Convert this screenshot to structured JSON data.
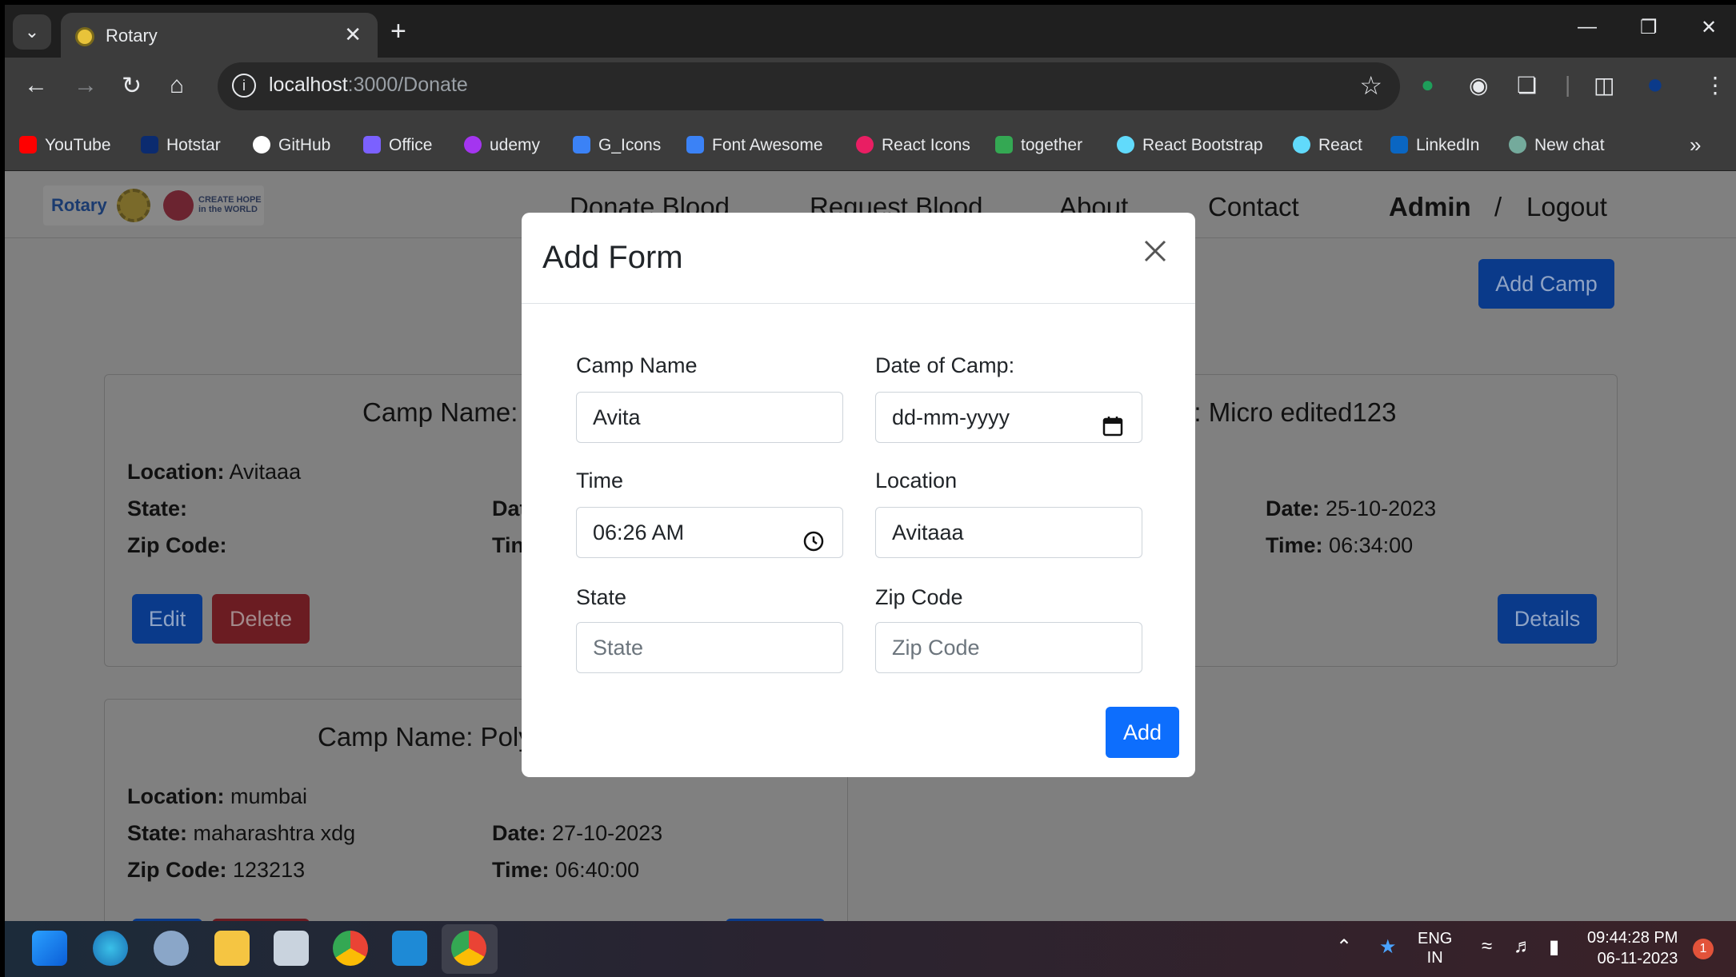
{
  "browser": {
    "tab_title": "Rotary",
    "url_host": "localhost",
    "url_path": ":3000/Donate",
    "bookmarks": [
      "YouTube",
      "Hotstar",
      "GitHub",
      "Office",
      "udemy",
      "G_Icons",
      "Font Awesome",
      "React Icons",
      "together",
      "React Bootstrap",
      "React",
      "LinkedIn",
      "New chat"
    ],
    "bookmark_colors": [
      "#ff0000",
      "#0b2b6f",
      "#ffffff",
      "#7b61ff",
      "#a435f0",
      "#3b82f6",
      "#3b82f6",
      "#e91e63",
      "#34a853",
      "#61dafb",
      "#61dafb",
      "#0a66c2",
      "#74aa9c"
    ]
  },
  "site": {
    "logo_text": "Rotary",
    "logo_tagline": "CREATE HOPE in the WORLD",
    "nav": {
      "donate": "Donate Blood",
      "request": "Request Blood",
      "about": "About",
      "contact": "Contact",
      "admin": "Admin",
      "separator": "/",
      "logout": "Logout"
    },
    "add_camp": "Add Camp"
  },
  "cards": {
    "card1": {
      "title": "Camp Name:",
      "location_label": "Location:",
      "location_value": "Avitaaa",
      "state_label": "State:",
      "zip_label": "Zip Code:",
      "date_label_partial": "Dat",
      "time_label_partial": "Tin",
      "edit": "Edit",
      "delete": "Delete"
    },
    "card2": {
      "title_partial": "e: Micro edited123",
      "date_label": "Date:",
      "date_value": "25-10-2023",
      "time_label": "Time:",
      "time_value": "06:34:00",
      "details": "Details"
    },
    "card3": {
      "title_partial": "Camp Name: Poly",
      "location_label": "Location:",
      "location_value": "mumbai",
      "state_label": "State:",
      "state_value": "maharashtra xdg",
      "zip_label": "Zip Code:",
      "zip_value": "123213",
      "date_label": "Date:",
      "date_value": "27-10-2023",
      "time_label": "Time:",
      "time_value": "06:40:00"
    }
  },
  "modal": {
    "title": "Add Form",
    "fields": {
      "camp_name": {
        "label": "Camp Name",
        "value": "Avita"
      },
      "date": {
        "label": "Date of Camp:",
        "value": "dd-mm-yyyy"
      },
      "time": {
        "label": "Time",
        "value": "06:26 AM"
      },
      "location": {
        "label": "Location",
        "value": "Avitaaa"
      },
      "state": {
        "label": "State",
        "placeholder": "State"
      },
      "zip": {
        "label": "Zip Code",
        "placeholder": "Zip Code"
      }
    },
    "submit": "Add",
    "accent_color": "#0d6efd"
  },
  "taskbar": {
    "lang_top": "ENG",
    "lang_bottom": "IN",
    "time": "09:44:28 PM",
    "date": "06-11-2023",
    "notification_count": "1"
  }
}
